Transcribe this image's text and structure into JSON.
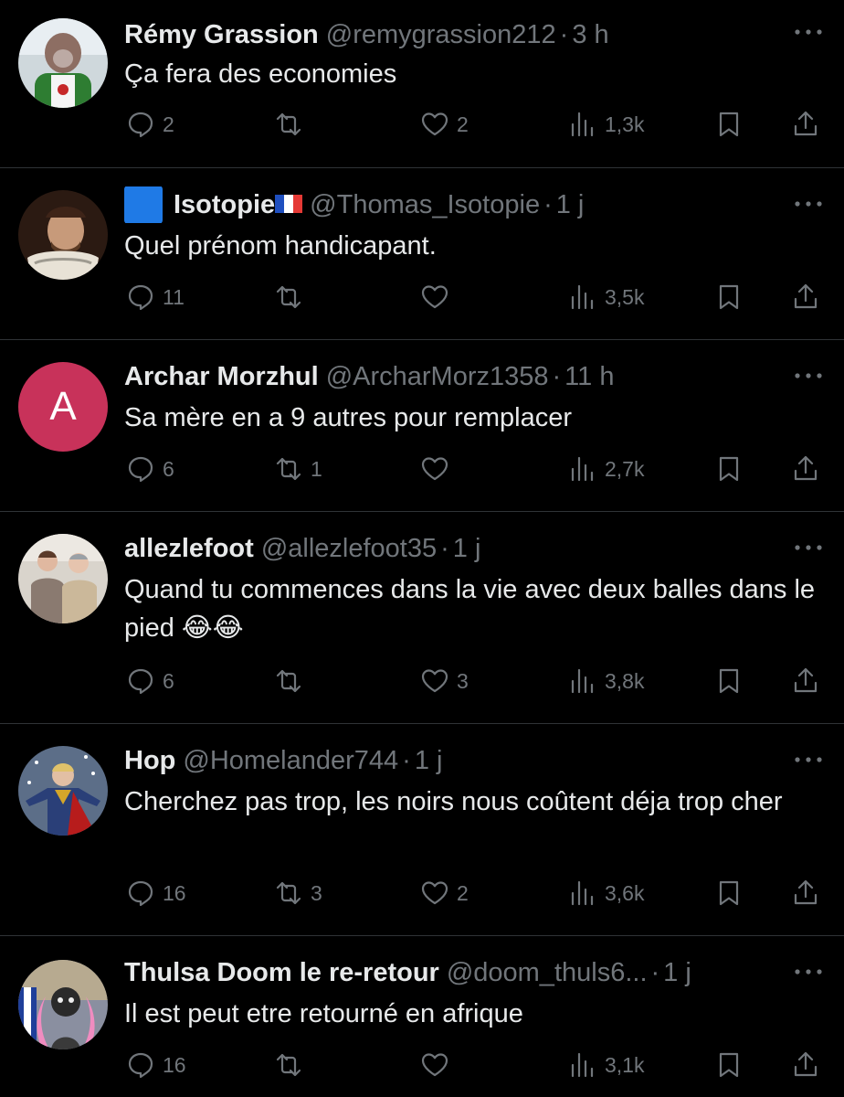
{
  "tweets": [
    {
      "name": "Rémy Grassion",
      "handle": "@remygrassion212",
      "time": "3 h",
      "text": "Ça fera des economies",
      "replies": "2",
      "reposts": "",
      "likes": "2",
      "views": "1,3k"
    },
    {
      "name": "Isotopie",
      "handle": "@Thomas_Isotopie",
      "time": "1 j",
      "text": "Quel prénom handicapant.",
      "replies": "11",
      "reposts": "",
      "likes": "",
      "views": "3,5k"
    },
    {
      "name": "Archar Morzhul",
      "handle": "@ArcharMorz1358",
      "time": "11 h",
      "text": "Sa mère en a 9 autres pour remplacer",
      "avatar_letter": "A",
      "replies": "6",
      "reposts": "1",
      "likes": "",
      "views": "2,7k"
    },
    {
      "name": "allezlefoot",
      "handle": "@allezlefoot35",
      "time": "1 j",
      "text": "Quand tu commences dans la vie avec deux balles dans le pied 😂😂",
      "replies": "6",
      "reposts": "",
      "likes": "3",
      "views": "3,8k"
    },
    {
      "name": "Hop",
      "handle": "@Homelander744",
      "time": "1 j",
      "text": "Cherchez pas trop, les noirs nous coûtent déja trop cher",
      "replies": "16",
      "reposts": "3",
      "likes": "2",
      "views": "3,6k"
    },
    {
      "name": "Thulsa Doom le re-retour",
      "handle": "@doom_thuls6...",
      "time": "1 j",
      "text": "Il est peut etre retourné en afrique",
      "replies": "16",
      "reposts": "",
      "likes": "",
      "views": "3,1k"
    }
  ],
  "separator": "·",
  "colors": {
    "background": "#000000",
    "text": "#e7e9ea",
    "muted": "#71767b",
    "divider": "#2f3336"
  }
}
